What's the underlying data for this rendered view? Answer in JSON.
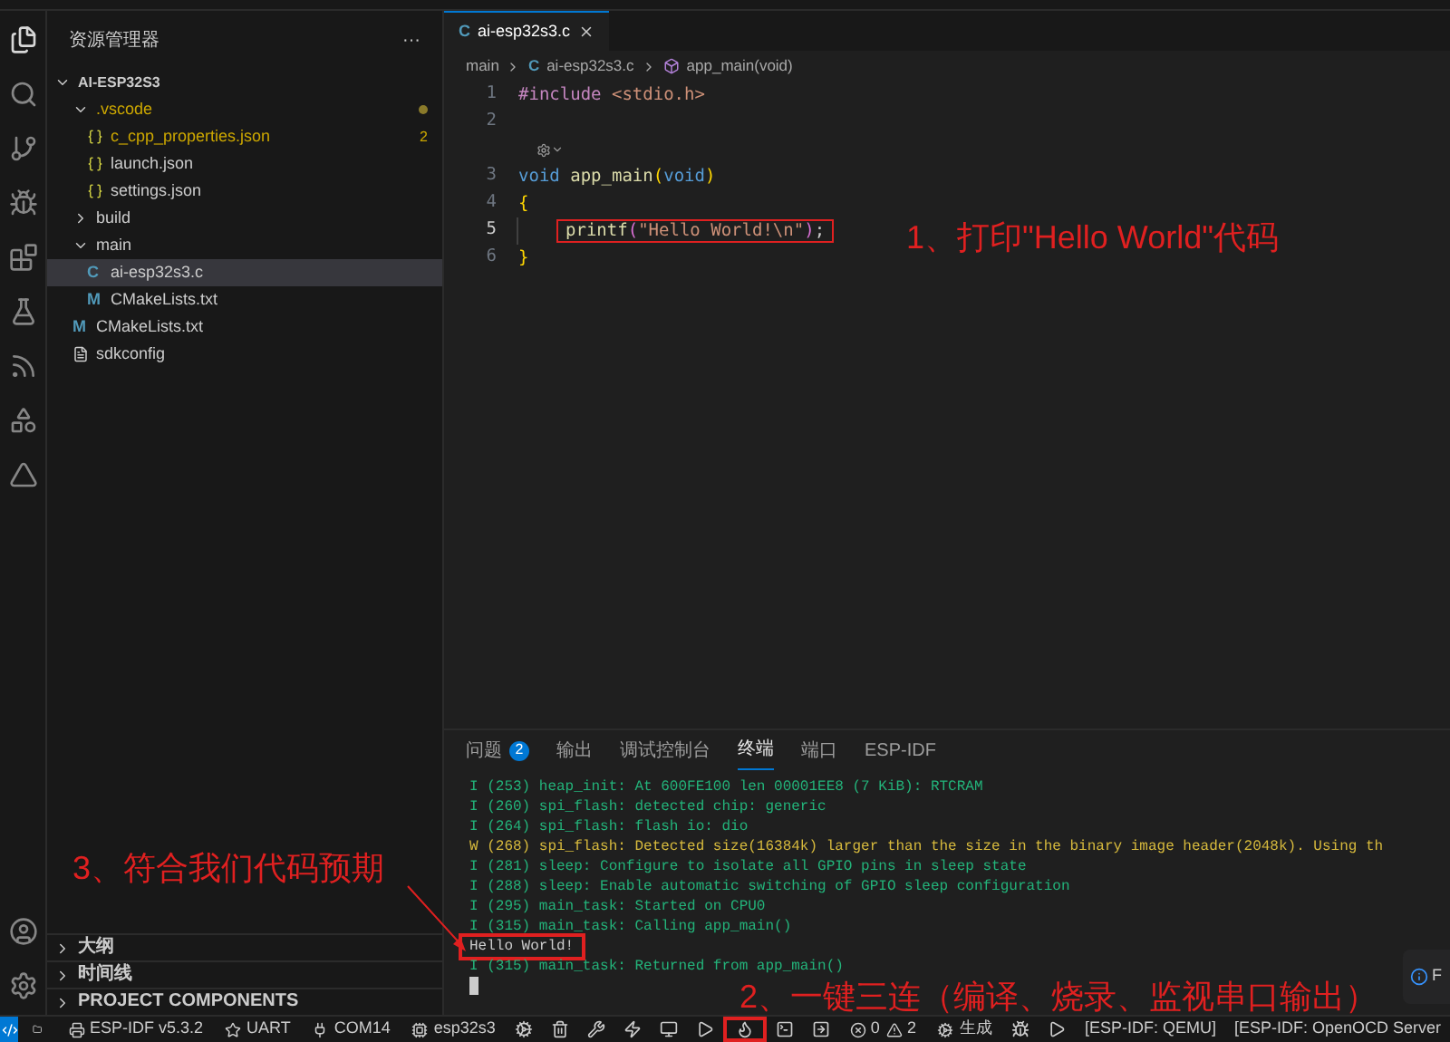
{
  "sidebar": {
    "title": "资源管理器",
    "more": "···",
    "root": {
      "name": "AI-ESP32S3",
      "expanded": true,
      "children": [
        {
          "name": ".vscode",
          "kind": "folder",
          "expanded": true,
          "warning": true,
          "modified": true,
          "selected": false,
          "children": [
            {
              "name": "c_cpp_properties.json",
              "kind": "json",
              "warning": true,
              "badge": "2",
              "selected": false
            },
            {
              "name": "launch.json",
              "kind": "json",
              "warning": false,
              "selected": false
            },
            {
              "name": "settings.json",
              "kind": "json",
              "warning": false,
              "selected": false
            }
          ]
        },
        {
          "name": "build",
          "kind": "folder",
          "expanded": false,
          "warning": false,
          "selected": false
        },
        {
          "name": "main",
          "kind": "folder",
          "expanded": true,
          "warning": false,
          "selected": false,
          "children": [
            {
              "name": "ai-esp32s3.c",
              "kind": "c",
              "icon": "C",
              "warning": false,
              "selected": true
            },
            {
              "name": "CMakeLists.txt",
              "kind": "cmake",
              "icon": "M",
              "warning": false,
              "selected": false
            }
          ]
        },
        {
          "name": "CMakeLists.txt",
          "kind": "cmake",
          "icon": "M",
          "warning": false,
          "selected": false
        },
        {
          "name": "sdkconfig",
          "kind": "config",
          "warning": false,
          "selected": false
        }
      ]
    },
    "sections": [
      {
        "name": "大纲",
        "expanded": false
      },
      {
        "name": "时间线",
        "expanded": false
      },
      {
        "name": "PROJECT COMPONENTS",
        "expanded": false
      }
    ]
  },
  "editor": {
    "tabs": [
      {
        "icon": "C",
        "label": "ai-esp32s3.c",
        "selected": true
      }
    ],
    "breadcrumb": [
      {
        "label": "main"
      },
      {
        "icon": "C",
        "label": "ai-esp32s3.c"
      },
      {
        "label": "app_main(void)"
      }
    ],
    "lines": [
      {
        "kind": "code",
        "number": "1",
        "current": false,
        "highlighted": false,
        "tokens": [
          {
            "text": "#include",
            "kind": "preproc"
          },
          {
            "text": " <stdio.h>",
            "kind": "string"
          }
        ]
      },
      {
        "kind": "code",
        "number": "2",
        "current": false,
        "highlighted": false
      },
      {
        "kind": "codelens"
      },
      {
        "kind": "code",
        "number": "3",
        "current": false,
        "highlighted": false,
        "tokens": [
          {
            "text": "void",
            "kind": "keyword"
          },
          {
            "text": " app_main",
            "kind": "func"
          },
          {
            "text": "(",
            "kind": "bracket1"
          },
          {
            "text": "void",
            "kind": "keyword"
          },
          {
            "text": ")",
            "kind": "bracket1"
          }
        ]
      },
      {
        "kind": "code",
        "number": "4",
        "current": false,
        "highlighted": false,
        "tokens": [
          {
            "text": "{",
            "kind": "bracket1"
          }
        ]
      },
      {
        "kind": "code",
        "number": "5",
        "current": true,
        "highlighted": true,
        "indent": true,
        "tokens": [
          {
            "text": "printf",
            "kind": "func"
          },
          {
            "text": "(",
            "kind": "bracket2"
          },
          {
            "text": "\"Hello World!\\n\"",
            "kind": "string"
          },
          {
            "text": ")",
            "kind": "bracket2"
          },
          {
            "text": ";",
            "kind": "plain"
          }
        ]
      },
      {
        "kind": "code",
        "number": "6",
        "current": false,
        "highlighted": false,
        "tokens": [
          {
            "text": "}",
            "kind": "bracket1"
          }
        ]
      }
    ]
  },
  "panel": {
    "tabs": [
      {
        "label": "问题",
        "badge": "2",
        "selected": false
      },
      {
        "label": "输出",
        "selected": false
      },
      {
        "label": "调试控制台",
        "selected": false
      },
      {
        "label": "终端",
        "selected": true
      },
      {
        "label": "端口",
        "selected": false
      },
      {
        "label": "ESP-IDF",
        "selected": false
      }
    ],
    "terminal": [
      {
        "kind": "info",
        "text": "I (253) heap_init: At 600FE100 len 00001EE8 (7 KiB): RTCRAM",
        "highlighted": false
      },
      {
        "kind": "info",
        "text": "I (260) spi_flash: detected chip: generic",
        "highlighted": false
      },
      {
        "kind": "info",
        "text": "I (264) spi_flash: flash io: dio",
        "highlighted": false
      },
      {
        "kind": "warn",
        "text": "W (268) spi_flash: Detected size(16384k) larger than the size in the binary image header(2048k). Using th",
        "highlighted": false
      },
      {
        "kind": "info",
        "text": "I (281) sleep: Configure to isolate all GPIO pins in sleep state",
        "highlighted": false
      },
      {
        "kind": "info",
        "text": "I (288) sleep: Enable automatic switching of GPIO sleep configuration",
        "highlighted": false
      },
      {
        "kind": "info",
        "text": "I (295) main_task: Started on CPU0",
        "highlighted": false
      },
      {
        "kind": "info",
        "text": "I (315) main_task: Calling app_main()",
        "highlighted": false
      },
      {
        "kind": "plain",
        "text": "Hello World!",
        "highlighted": true
      },
      {
        "kind": "info",
        "text": "I (315) main_task: Returned from app_main()",
        "highlighted": false
      }
    ],
    "notification": "F"
  },
  "status_bar": {
    "left": [
      {
        "kind": "remote"
      },
      {
        "kind": "icon",
        "highlighted": false
      },
      {
        "kind": "labeled",
        "label": "ESP-IDF v5.3.2"
      },
      {
        "kind": "labeled",
        "label": "UART"
      },
      {
        "kind": "labeled",
        "label": "COM14"
      },
      {
        "kind": "labeled",
        "label": "esp32s3"
      },
      {
        "kind": "icon",
        "highlighted": false
      },
      {
        "kind": "icon",
        "highlighted": false
      },
      {
        "kind": "icon",
        "highlighted": false
      },
      {
        "kind": "icon",
        "highlighted": false
      },
      {
        "kind": "icon",
        "highlighted": false
      },
      {
        "kind": "icon",
        "highlighted": false
      },
      {
        "kind": "icon",
        "highlighted": true
      },
      {
        "kind": "icon",
        "highlighted": false
      },
      {
        "kind": "icon",
        "highlighted": false
      },
      {
        "kind": "problems",
        "errors": "0",
        "warnings": "2"
      },
      {
        "kind": "labeled",
        "label": "生成"
      },
      {
        "kind": "icon",
        "highlighted": false
      },
      {
        "kind": "icon",
        "highlighted": false
      }
    ],
    "right": [
      "[ESP-IDF: QEMU]",
      "[ESP-IDF: OpenOCD Server"
    ]
  },
  "annotations": [
    "1、打印\"Hello World\"代码",
    "2、一键三连（编译、烧录、监视串口输出）",
    "3、符合我们代码预期"
  ]
}
